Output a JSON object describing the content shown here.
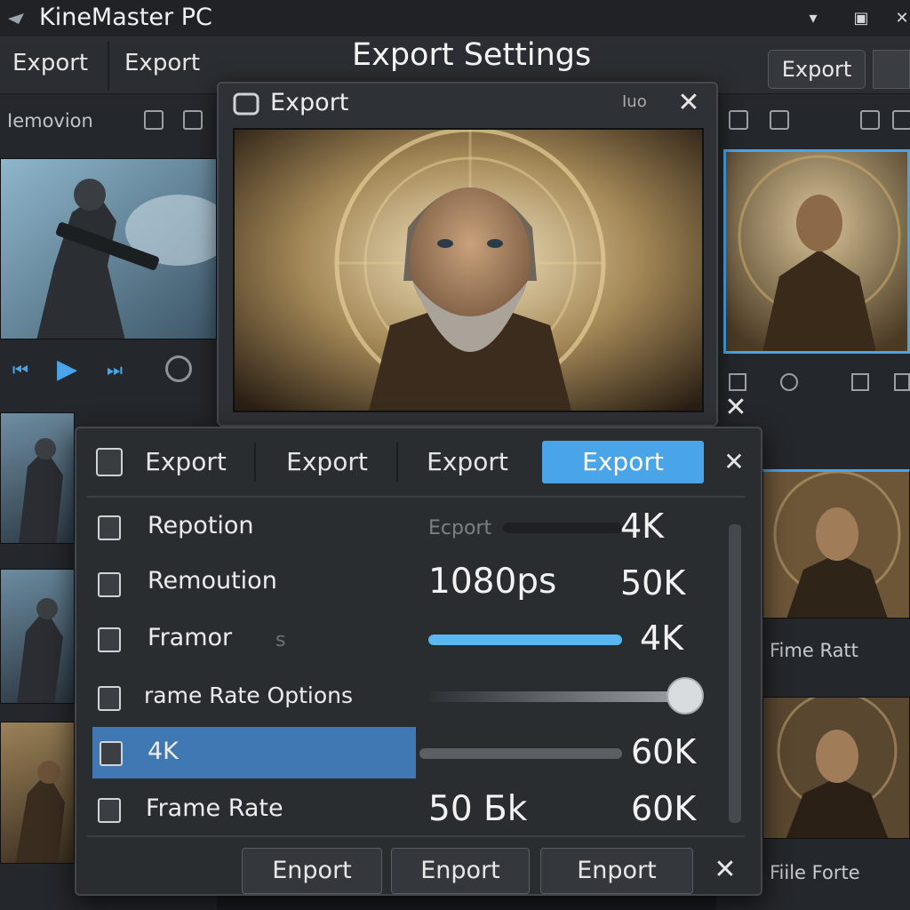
{
  "app": {
    "title": "KineMaster PC"
  },
  "menu": {
    "items": [
      "Export",
      "Export"
    ],
    "heading": "Export Settings",
    "right_button": "Export"
  },
  "left_panel": {
    "tool_label": "Iemovion"
  },
  "right_panel": {
    "label_1": "Fime Ratt",
    "label_2": "Fiile Forte"
  },
  "export_dialog": {
    "title": "Export",
    "misc": "Iuo"
  },
  "settings_dialog": {
    "tabs": [
      {
        "label": "Export",
        "active": false
      },
      {
        "label": "Export",
        "active": false
      },
      {
        "label": "Export",
        "active": false
      },
      {
        "label": "Export",
        "active": true
      }
    ],
    "rows": [
      {
        "label": "Repotion",
        "mid": "Ecport",
        "value": "4K",
        "slider": 0.0
      },
      {
        "label": "Remoution",
        "mid": "1080ps",
        "value": "50K",
        "slider": null
      },
      {
        "label": "Framor",
        "mid": "s",
        "value": "4K",
        "slider": 1.0
      },
      {
        "label": "rame Rate Options",
        "mid": "",
        "value": "",
        "slider": 1.0
      },
      {
        "label": "4K",
        "mid": "",
        "value": "60K",
        "slider": 0.0
      },
      {
        "label": "Frame Rate",
        "mid": "50 Бk",
        "value": "60K",
        "slider": null
      }
    ],
    "footer_buttons": [
      "Enport",
      "Enport",
      "Enport"
    ]
  },
  "colors": {
    "accent": "#4aa4e8",
    "slider_fill": "#5bb7f0",
    "highlight": "#3f78b3"
  }
}
